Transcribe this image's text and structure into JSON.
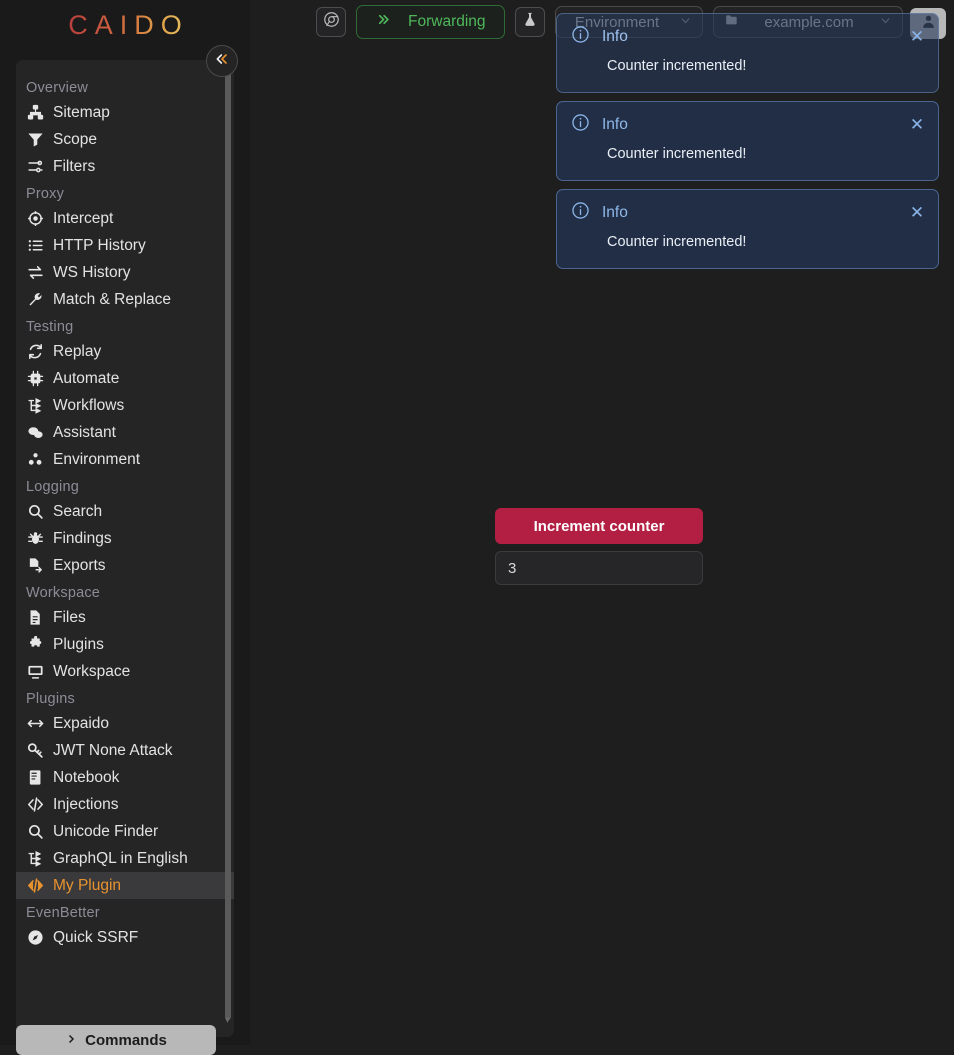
{
  "app": {
    "logo_text": "CAIDO"
  },
  "sidebar": {
    "collapse_icon": "chevrons-left-icon",
    "scrollbar": "vertical-scrollbar",
    "commands_label": "Commands",
    "sections": [
      {
        "title": "Overview",
        "items": [
          {
            "label": "Sitemap",
            "icon": "sitemap-icon",
            "active": false
          },
          {
            "label": "Scope",
            "icon": "filter-funnel-icon",
            "active": false
          },
          {
            "label": "Filters",
            "icon": "sliders-icon",
            "active": false
          }
        ]
      },
      {
        "title": "Proxy",
        "items": [
          {
            "label": "Intercept",
            "icon": "crosshair-icon",
            "active": false
          },
          {
            "label": "HTTP History",
            "icon": "list-icon",
            "active": false
          },
          {
            "label": "WS History",
            "icon": "exchange-arrows-icon",
            "active": false
          },
          {
            "label": "Match & Replace",
            "icon": "wrench-icon",
            "active": false
          }
        ]
      },
      {
        "title": "Testing",
        "items": [
          {
            "label": "Replay",
            "icon": "refresh-icon",
            "active": false
          },
          {
            "label": "Automate",
            "icon": "cpu-chip-icon",
            "active": false
          },
          {
            "label": "Workflows",
            "icon": "workflow-nodes-icon",
            "active": false
          },
          {
            "label": "Assistant",
            "icon": "chat-bubbles-icon",
            "active": false
          },
          {
            "label": "Environment",
            "icon": "molecule-icon",
            "active": false
          }
        ]
      },
      {
        "title": "Logging",
        "items": [
          {
            "label": "Search",
            "icon": "search-icon",
            "active": false
          },
          {
            "label": "Findings",
            "icon": "bug-icon",
            "active": false
          },
          {
            "label": "Exports",
            "icon": "file-export-icon",
            "active": false
          }
        ]
      },
      {
        "title": "Workspace",
        "items": [
          {
            "label": "Files",
            "icon": "file-icon",
            "active": false
          },
          {
            "label": "Plugins",
            "icon": "puzzle-piece-icon",
            "active": false
          },
          {
            "label": "Workspace",
            "icon": "monitor-icon",
            "active": false
          }
        ]
      },
      {
        "title": "Plugins",
        "items": [
          {
            "label": "Expaido",
            "icon": "arrows-horizontal-icon",
            "active": false
          },
          {
            "label": "JWT None Attack",
            "icon": "key-icon",
            "active": false
          },
          {
            "label": "Notebook",
            "icon": "book-icon",
            "active": false
          },
          {
            "label": "Injections",
            "icon": "code-brackets-icon",
            "active": false
          },
          {
            "label": "Unicode Finder",
            "icon": "search-icon",
            "active": false
          },
          {
            "label": "GraphQL in English",
            "icon": "workflow-nodes-icon",
            "active": false
          },
          {
            "label": "My Plugin",
            "icon": "code-brackets-icon",
            "active": true
          }
        ]
      },
      {
        "title": "EvenBetter",
        "items": [
          {
            "label": "Quick SSRF",
            "icon": "compass-icon",
            "active": false
          }
        ]
      }
    ]
  },
  "toolbar": {
    "browser_icon": "chrome-browser-icon",
    "forwarding_label": "Forwarding",
    "forwarding_icon": "chevrons-right-icon",
    "flask_icon": "flask-icon",
    "environment_label": "Environment",
    "environment_chevron": "chevron-down-icon",
    "project_label": "example.com",
    "project_icon": "folder-icon",
    "project_chevron": "chevron-down-icon",
    "avatar_icon": "user-avatar-icon"
  },
  "main": {
    "increment_button_label": "Increment counter",
    "counter_value": "3",
    "counter_placeholder": ""
  },
  "toasts": [
    {
      "severity": "Info",
      "message": "Counter incremented!",
      "icon": "info-circle-icon",
      "close_icon": "close-icon",
      "translucent": true
    },
    {
      "severity": "Info",
      "message": "Counter incremented!",
      "icon": "info-circle-icon",
      "close_icon": "close-icon",
      "translucent": false
    },
    {
      "severity": "Info",
      "message": "Counter incremented!",
      "icon": "info-circle-icon",
      "close_icon": "close-icon",
      "translucent": false
    }
  ],
  "colors": {
    "accent_orange": "#e8922e",
    "brand_red": "#b5393c",
    "brand_gold": "#e8c164",
    "forwarding_green": "#4eb85b",
    "increment_crimson": "#b21f43",
    "toast_blue": "#8fb8e8",
    "sidebar_bg": "#252526",
    "main_bg": "#1e1e1e"
  }
}
